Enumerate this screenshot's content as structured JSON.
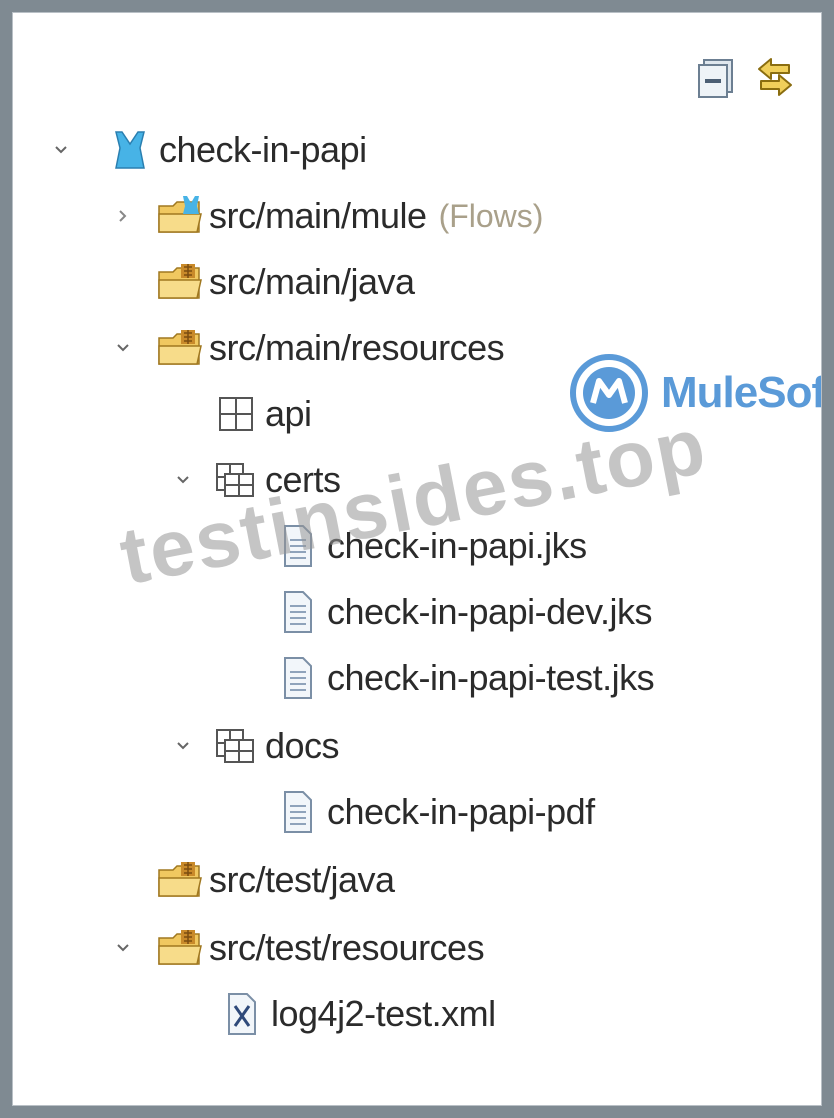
{
  "tree": {
    "root": {
      "label": "check-in-papi",
      "icon": "mule-project-icon"
    },
    "items": [
      {
        "label": "src/main/mule",
        "decoration": "(Flows)",
        "icon": "mule-folder-icon"
      },
      {
        "label": "src/main/java",
        "icon": "source-folder-icon"
      },
      {
        "label": "src/main/resources",
        "icon": "source-folder-icon"
      },
      {
        "label": "api",
        "icon": "package-icon"
      },
      {
        "label": "certs",
        "icon": "package-icon"
      },
      {
        "label": "check-in-papi.jks",
        "icon": "file-icon"
      },
      {
        "label": "check-in-papi-dev.jks",
        "icon": "file-icon"
      },
      {
        "label": "check-in-papi-test.jks",
        "icon": "file-icon"
      },
      {
        "label": "docs",
        "icon": "package-icon"
      },
      {
        "label": "check-in-papi-pdf",
        "icon": "file-icon"
      },
      {
        "label": "src/test/java",
        "icon": "source-folder-icon"
      },
      {
        "label": "src/test/resources",
        "icon": "source-folder-icon"
      },
      {
        "label": "log4j2-test.xml",
        "icon": "xml-file-icon"
      }
    ]
  },
  "toolbar": {
    "collapse_all": "collapse-all-icon",
    "link_with_editor": "link-with-editor-icon"
  },
  "logo": {
    "text": "MuleSoft",
    "color": "#5a9ad8"
  },
  "watermark": {
    "text": "testinsides.top"
  }
}
